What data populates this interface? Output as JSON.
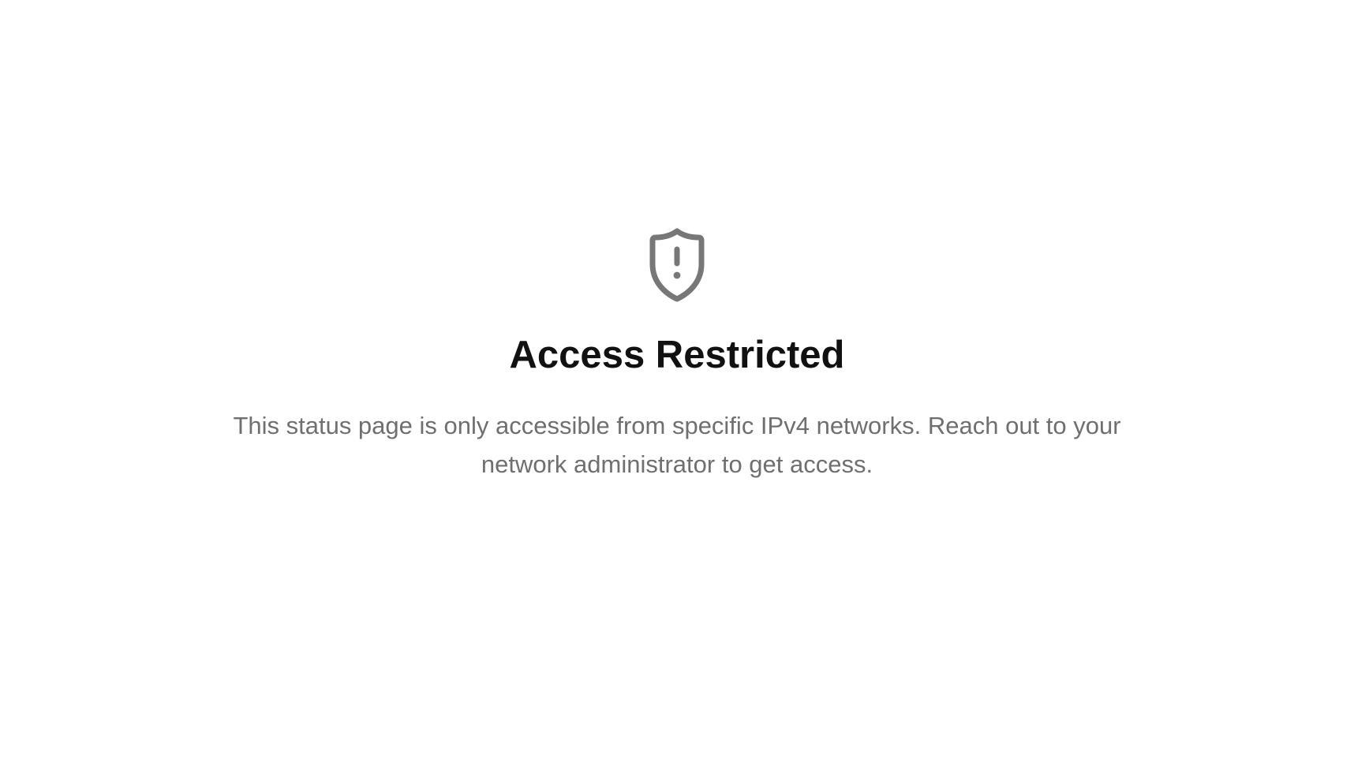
{
  "icon": {
    "name": "shield-alert-icon",
    "color": "#777777"
  },
  "status": {
    "title": "Access Restricted",
    "message": "This status page is only accessible from specific IPv4 networks. Reach out to your network administrator to get access."
  },
  "colors": {
    "background": "#ffffff",
    "title": "#111111",
    "message": "#6f6f6f"
  }
}
